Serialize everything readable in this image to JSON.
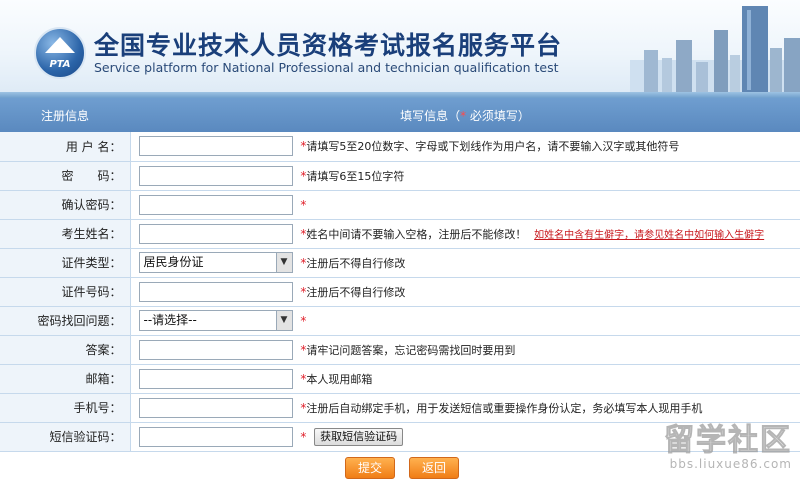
{
  "header": {
    "logo_text": "PTA",
    "title_cn": "全国专业技术人员资格考试报名服务平台",
    "title_en": "Service platform for National Professional and technician  qualification test"
  },
  "table_header": {
    "col1": "注册信息",
    "col2_prefix": "填写信息（",
    "col2_star": "*",
    "col2_suffix": " 必须填写）"
  },
  "fields": [
    {
      "label": "用 户 名：",
      "type": "text",
      "value": "",
      "hint": "请填写5至20位数字、字母或下划线作为用户名，请不要输入汉字或其他符号"
    },
    {
      "label": "密　　码：",
      "type": "text",
      "value": "",
      "hint": "请填写6至15位字符"
    },
    {
      "label": "确认密码：",
      "type": "text",
      "value": "",
      "hint": ""
    },
    {
      "label": "考生姓名：",
      "type": "text",
      "value": "",
      "hint": "姓名中间请不要输入空格，注册后不能修改！",
      "link": "如姓名中含有生僻字，请参见姓名中如何输入生僻字"
    },
    {
      "label": "证件类型：",
      "type": "select",
      "value": "居民身份证",
      "hint": "注册后不得自行修改"
    },
    {
      "label": "证件号码：",
      "type": "text",
      "value": "",
      "hint": "注册后不得自行修改"
    },
    {
      "label": "密码找回问题：",
      "type": "select",
      "value": "--请选择--",
      "hint": ""
    },
    {
      "label": "答案：",
      "type": "text",
      "value": "",
      "hint": "请牢记问题答案，忘记密码需找回时要用到"
    },
    {
      "label": "邮箱：",
      "type": "text",
      "value": "",
      "hint": "本人现用邮箱"
    },
    {
      "label": "手机号：",
      "type": "text",
      "value": "",
      "hint": "注册后自动绑定手机，用于发送短信或重要操作身份认定，务必填写本人现用手机"
    },
    {
      "label": "短信验证码：",
      "type": "sms",
      "value": "",
      "hint": "",
      "button": "获取短信验证码"
    }
  ],
  "star": "*",
  "buttons": {
    "submit": "提交",
    "back": "返回"
  },
  "watermark": {
    "big": "留学社区",
    "small": "bbs.liuxue86.com"
  },
  "colors": {
    "header_bar": "#5a89bf",
    "required": "#e0202a",
    "button": "#f07d16",
    "title": "#1a3f7a"
  }
}
